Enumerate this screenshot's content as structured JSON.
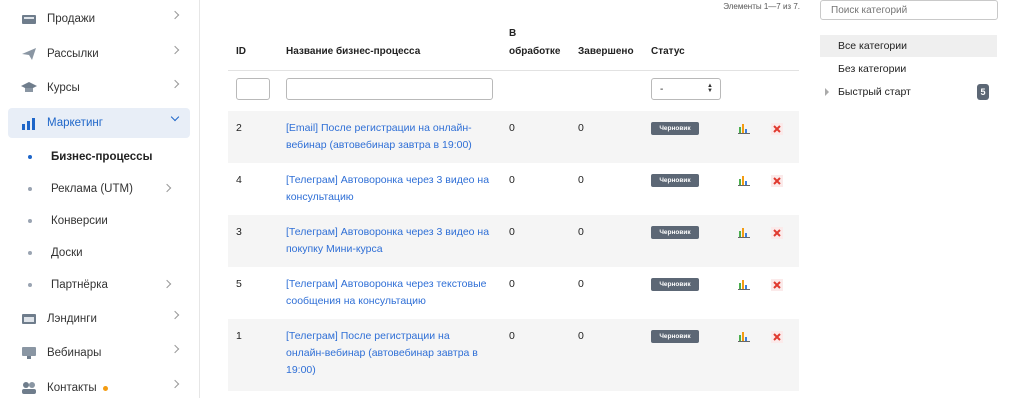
{
  "sidebar": {
    "items": [
      {
        "label": "Продажи"
      },
      {
        "label": "Рассылки"
      },
      {
        "label": "Курсы"
      },
      {
        "label": "Маркетинг"
      },
      {
        "label": "Лэндинги"
      },
      {
        "label": "Вебинары"
      },
      {
        "label": "Контакты"
      }
    ],
    "sub_items": [
      {
        "label": "Бизнес-процессы"
      },
      {
        "label": "Реклама (UTM)"
      },
      {
        "label": "Конверсии"
      },
      {
        "label": "Доски"
      },
      {
        "label": "Партнёрка"
      }
    ],
    "accent_color": "#1e66c9",
    "notification_color": "#f39c12"
  },
  "pager": {
    "text": "Элементы 1—7 из 7."
  },
  "table": {
    "headers": {
      "id": "ID",
      "name": "Название бизнес-процесса",
      "processing_line1": "В",
      "processing_line2": "обработке",
      "done": "Завершено",
      "status": "Статус"
    },
    "status_filter_value": "-",
    "rows": [
      {
        "id": "2",
        "name_line1": "[Email] После регистрации на онлайн-",
        "name_line2": "вебинар (автовебинар завтра в 19:00)",
        "name_line3": "",
        "processing": "0",
        "done": "0",
        "status": "Черновик"
      },
      {
        "id": "4",
        "name_line1": "[Телеграм] Автоворонка через 3 видео на",
        "name_line2": "консультацию",
        "name_line3": "",
        "processing": "0",
        "done": "0",
        "status": "Черновик"
      },
      {
        "id": "3",
        "name_line1": "[Телеграм] Автоворонка через 3 видео на",
        "name_line2": "покупку Мини-курса",
        "name_line3": "",
        "processing": "0",
        "done": "0",
        "status": "Черновик"
      },
      {
        "id": "5",
        "name_line1": "[Телеграм] Автоворонка через текстовые",
        "name_line2": "сообщения на консультацию",
        "name_line3": "",
        "processing": "0",
        "done": "0",
        "status": "Черновик"
      },
      {
        "id": "1",
        "name_line1": "[Телеграм] После регистрации на",
        "name_line2": "онлайн-вебинар (автовебинар завтра в",
        "name_line3": "19:00)",
        "processing": "0",
        "done": "0",
        "status": "Черновик"
      }
    ],
    "link_color": "#2f6fd6",
    "badge_color": "#5c6775"
  },
  "categories": {
    "search_placeholder": "Поиск категорий",
    "items": [
      {
        "label": "Все категории"
      },
      {
        "label": "Без категории"
      },
      {
        "label": "Быстрый старт",
        "count": "5"
      }
    ]
  }
}
